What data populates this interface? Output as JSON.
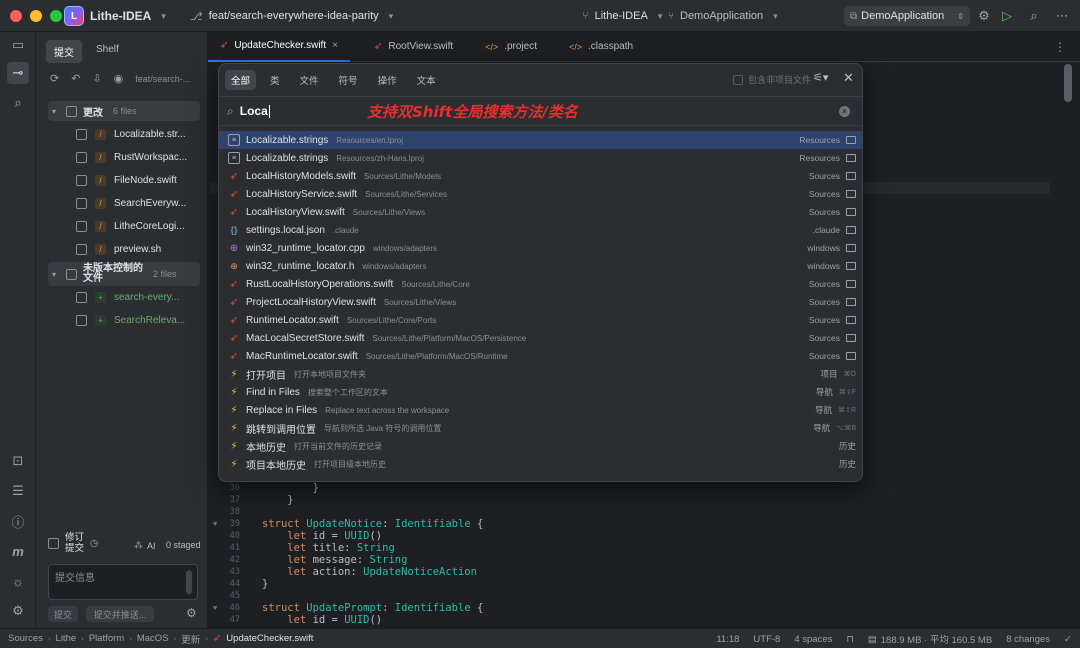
{
  "titlebar": {
    "app_name": "Lithe-IDEA",
    "branch": "feat/search-everywhere-idea-parity",
    "project": "Lithe-IDEA",
    "module": "DemoApplication",
    "run_config": "DemoApplication"
  },
  "commit_panel": {
    "tabs": [
      "提交",
      "Shelf"
    ],
    "branch_short": "feat/search-...",
    "changes_group": {
      "label": "更改",
      "count": "6 files"
    },
    "changed_files": [
      "Localizable.str...",
      "RustWorkspac...",
      "FileNode.swift",
      "SearchEveryw...",
      "LitheCoreLogi...",
      "preview.sh"
    ],
    "unversioned_group": {
      "label_line1": "未版本控制的",
      "label_line2": "文件",
      "count": "2 files"
    },
    "unversioned_files": [
      "search-every...",
      "SearchReleva..."
    ],
    "amend_label_line1": "修订",
    "amend_label_line2": "提交",
    "ai_label": "AI",
    "staged": "0 staged",
    "commit_placeholder": "提交信息",
    "commit_button": "提交",
    "commit_push_button": "提交并推送..."
  },
  "editor_tabs": [
    {
      "label": "UpdateChecker.swift",
      "type": "swift"
    },
    {
      "label": "RootView.swift",
      "type": "swift"
    },
    {
      "label": ".project",
      "type": "xml"
    },
    {
      "label": ".classpath",
      "type": "xml"
    }
  ],
  "code_lines": [
    {
      "num": "36",
      "text": "        }"
    },
    {
      "num": "37",
      "text": "    }"
    },
    {
      "num": "38",
      "text": ""
    },
    {
      "num": "39",
      "kw": "struct ",
      "ty": "UpdateNotice",
      "rest": ": ",
      "ty2": "Identifiable",
      "tail": " {"
    },
    {
      "num": "40",
      "kw": "    let ",
      "rest": "id = ",
      "ty": "UUID",
      "tail": "()"
    },
    {
      "num": "41",
      "kw": "    let ",
      "rest": "title: ",
      "ty": "String",
      "tail": ""
    },
    {
      "num": "42",
      "kw": "    let ",
      "rest": "message: ",
      "ty": "String",
      "tail": ""
    },
    {
      "num": "43",
      "kw": "    let ",
      "rest": "action: ",
      "ty": "UpdateNoticeAction",
      "tail": ""
    },
    {
      "num": "44",
      "text": "}"
    },
    {
      "num": "45",
      "text": ""
    },
    {
      "num": "46",
      "kw": "struct ",
      "ty": "UpdatePrompt",
      "rest": ": ",
      "ty2": "Identifiable",
      "tail": " {"
    },
    {
      "num": "47",
      "kw": "    let ",
      "rest": "id = ",
      "ty": "UUID",
      "tail": "()"
    }
  ],
  "search_popup": {
    "tabs": [
      "全部",
      "类",
      "文件",
      "符号",
      "操作",
      "文本"
    ],
    "include_non_project": "包含非项目文件",
    "query": "Loca",
    "annotation": "支持双Shift全局搜索方法/类名",
    "results": [
      {
        "name": "Localizable.strings",
        "path": "Resources/en.lproj",
        "right": "Resources",
        "icon": "strings-file-icon",
        "kind": "str",
        "folder": true
      },
      {
        "name": "Localizable.strings",
        "path": "Resources/zh-Hans.lproj",
        "right": "Resources",
        "icon": "strings-file-icon",
        "kind": "str",
        "folder": true
      },
      {
        "name": "LocalHistoryModels.swift",
        "path": "Sources/Lithe/Models",
        "right": "Sources",
        "icon": "swift-file-icon",
        "kind": "swift",
        "folder": true
      },
      {
        "name": "LocalHistoryService.swift",
        "path": "Sources/Lithe/Services",
        "right": "Sources",
        "icon": "swift-file-icon",
        "kind": "swift",
        "folder": true
      },
      {
        "name": "LocalHistoryView.swift",
        "path": "Sources/Lithe/Views",
        "right": "Sources",
        "icon": "swift-file-icon",
        "kind": "swift",
        "folder": true
      },
      {
        "name": "settings.local.json",
        "path": ".claude",
        "right": ".claude",
        "icon": "json-file-icon",
        "kind": "json",
        "folder": true
      },
      {
        "name": "win32_runtime_locator.cpp",
        "path": "windows/adapters",
        "right": "windows",
        "icon": "cpp-file-icon",
        "kind": "cpp",
        "folder": true
      },
      {
        "name": "win32_runtime_locator.h",
        "path": "windows/adapters",
        "right": "windows",
        "icon": "header-file-icon",
        "kind": "h",
        "folder": true
      },
      {
        "name": "RustLocalHistoryOperations.swift",
        "path": "Sources/Lithe/Core",
        "right": "Sources",
        "icon": "swift-file-icon",
        "kind": "swift",
        "folder": true
      },
      {
        "name": "ProjectLocalHistoryView.swift",
        "path": "Sources/Lithe/Views",
        "right": "Sources",
        "icon": "swift-file-icon",
        "kind": "swift",
        "folder": true
      },
      {
        "name": "RuntimeLocator.swift",
        "path": "Sources/Lithe/Core/Ports",
        "right": "Sources",
        "icon": "swift-file-icon",
        "kind": "swift",
        "folder": true
      },
      {
        "name": "MacLocalSecretStore.swift",
        "path": "Sources/Lithe/Platform/MacOS/Persistence",
        "right": "Sources",
        "icon": "swift-file-icon",
        "kind": "swift",
        "folder": true
      },
      {
        "name": "MacRuntimeLocator.swift",
        "path": "Sources/Lithe/Platform/MacOS/Runtime",
        "right": "Sources",
        "icon": "swift-file-icon",
        "kind": "swift",
        "folder": true
      },
      {
        "name": "打开项目",
        "path": "打开本地项目文件夹",
        "right": "项目",
        "shortcut": "⌘O",
        "icon": "action-icon",
        "kind": "act",
        "folder": false
      },
      {
        "name": "Find in Files",
        "path": "搜索整个工作区的文本",
        "right": "导航",
        "shortcut": "⌘⇧F",
        "icon": "action-icon",
        "kind": "act",
        "folder": false
      },
      {
        "name": "Replace in Files",
        "path": "Replace text across the workspace",
        "right": "导航",
        "shortcut": "⌘⇧R",
        "icon": "action-icon",
        "kind": "act",
        "folder": false
      },
      {
        "name": "跳转到调用位置",
        "path": "导航到所选 Java 符号的调用位置",
        "right": "导航",
        "shortcut": "⌥⌘B",
        "icon": "action-icon",
        "kind": "act",
        "folder": false
      },
      {
        "name": "本地历史",
        "path": "打开当前文件的历史记录",
        "right": "历史",
        "icon": "action-icon",
        "kind": "act",
        "folder": false
      },
      {
        "name": "项目本地历史",
        "path": "打开项目级本地历史",
        "right": "历史",
        "icon": "action-icon",
        "kind": "act",
        "folder": false
      }
    ]
  },
  "statusbar": {
    "breadcrumb": [
      "Sources",
      "Lithe",
      "Platform",
      "MacOS",
      "更新",
      "UpdateChecker.swift"
    ],
    "position": "11:18",
    "encoding": "UTF-8",
    "indent": "4 spaces",
    "memory": "188.9 MB · 平均 160.5 MB",
    "changes": "8 changes"
  }
}
